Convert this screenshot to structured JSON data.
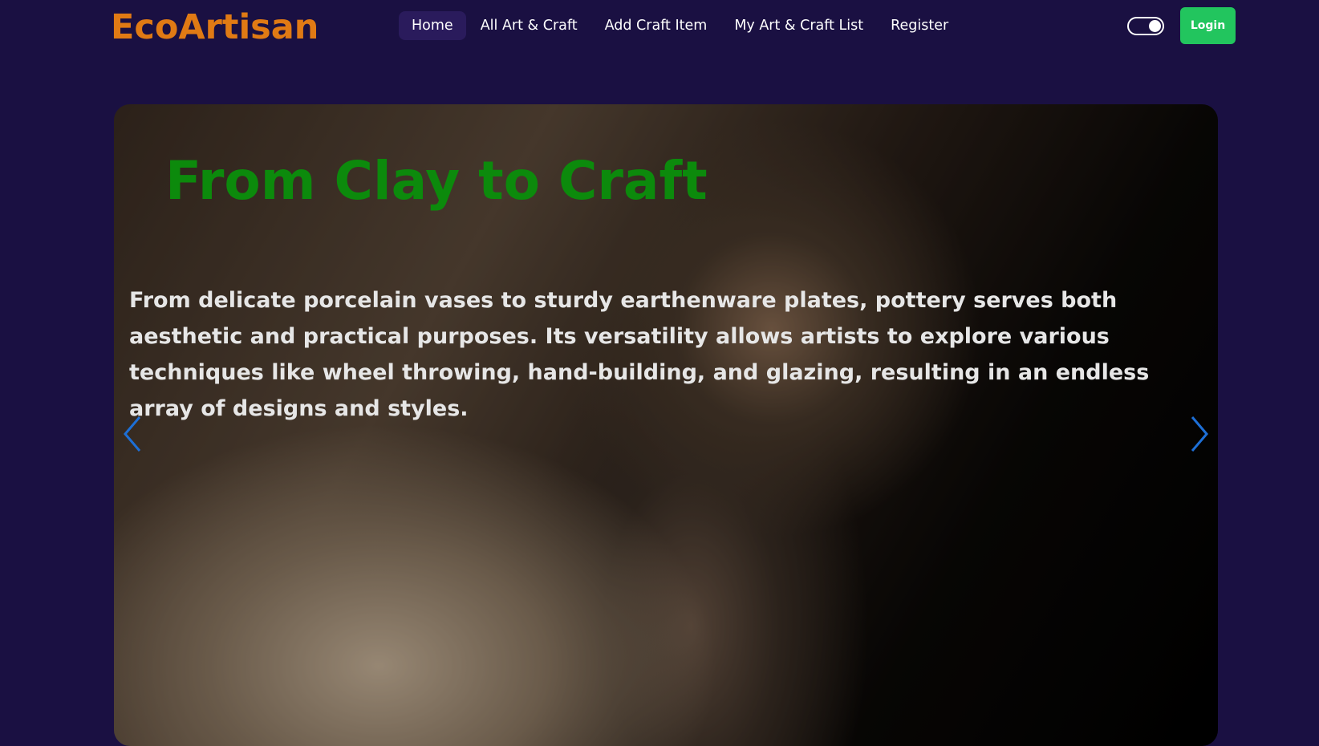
{
  "brand": {
    "logo_text": "EcoArtisan",
    "logo_color": "#e07a14"
  },
  "nav": {
    "items": [
      {
        "label": "Home",
        "active": true
      },
      {
        "label": "All Art & Craft",
        "active": false
      },
      {
        "label": "Add Craft Item",
        "active": false
      },
      {
        "label": "My Art & Craft List",
        "active": false
      },
      {
        "label": "Register",
        "active": false
      }
    ]
  },
  "header_actions": {
    "theme_toggle_icon": "toggle-switch-icon",
    "login_label": "Login",
    "login_color": "#22c55e"
  },
  "hero": {
    "title": "From Clay to Craft",
    "title_color": "#0c8a0c",
    "description": "From delicate porcelain vases to sturdy earthenware plates, pottery serves both aesthetic and practical purposes. Its versatility allows artists to explore various techniques like wheel throwing, hand-building, and glazing, resulting in an endless array of designs and styles.",
    "prev_icon": "chevron-left-icon",
    "next_icon": "chevron-right-icon",
    "arrow_color": "#1d6fd6"
  },
  "colors": {
    "page_background": "#1a1042",
    "nav_active_background": "#2a1b5c"
  }
}
